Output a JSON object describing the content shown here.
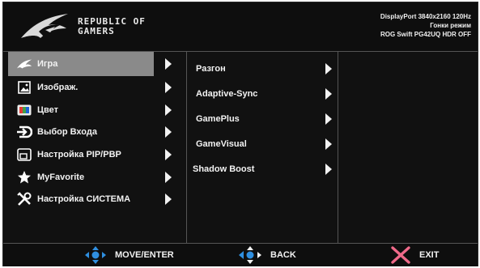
{
  "brand": {
    "line1": "REPUBLIC OF",
    "line2": "GAMERS"
  },
  "status": {
    "line1": "DisplayPort 3840x2160 120Hz",
    "line2": "Гонки режим",
    "line3": "ROG Swift PG42UQ HDR OFF"
  },
  "menu": {
    "items": [
      {
        "label": "Игра",
        "icon": "rog-eye-icon",
        "selected": true
      },
      {
        "label": "Изображ.",
        "icon": "image-icon"
      },
      {
        "label": "Цвет",
        "icon": "color-bars-icon"
      },
      {
        "label": "Выбор Входа",
        "icon": "input-icon"
      },
      {
        "label": "Настройка PIP/PBP",
        "icon": "pip-icon"
      },
      {
        "label": "MyFavorite",
        "icon": "star-icon"
      },
      {
        "label": "Настройка СИСТЕМА",
        "icon": "tools-icon"
      }
    ]
  },
  "submenu": {
    "items": [
      {
        "label": "Разгон"
      },
      {
        "label": "Adaptive-Sync"
      },
      {
        "label": "GamePlus"
      },
      {
        "label": "GameVisual"
      },
      {
        "label": "Shadow Boost"
      }
    ]
  },
  "footer": {
    "move": "MOVE/ENTER",
    "back": "BACK",
    "exit": "EXIT"
  },
  "colors": {
    "background": "#111111",
    "selected": "#8a8a8a",
    "accent_blue": "#2f8fe0",
    "exit_pink": "#f06a8a"
  }
}
